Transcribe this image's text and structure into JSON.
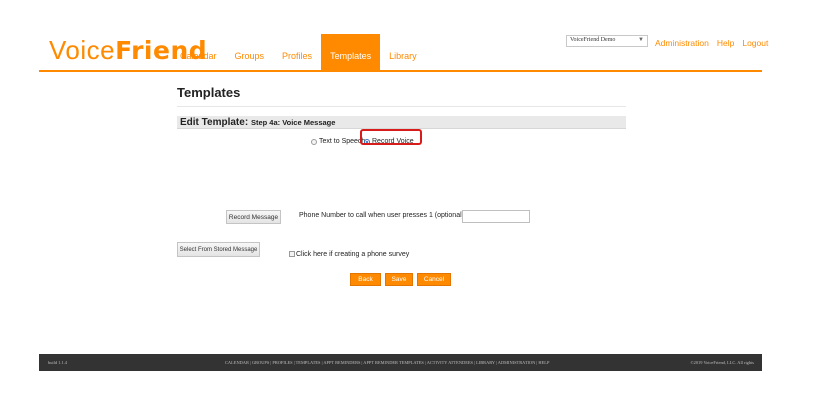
{
  "brand": {
    "logo_light": "Voice",
    "logo_bold": "Friend"
  },
  "nav": {
    "items": [
      {
        "label": "Calendar"
      },
      {
        "label": "Groups"
      },
      {
        "label": "Profiles"
      },
      {
        "label": "Templates",
        "active": true
      },
      {
        "label": "Library"
      }
    ]
  },
  "account": {
    "selected": "VoiceFriend Demo"
  },
  "top_links": {
    "administration": "Administration",
    "help": "Help",
    "logout": "Logout"
  },
  "page": {
    "title": "Templates",
    "section_title": "Edit Template:",
    "section_subtitle": "Step 4a: Voice Message",
    "options": {
      "text_to_speech": "Text to Speech",
      "record_voice": "Record Voice",
      "selected": "record_voice"
    },
    "record_button": "Record Message",
    "phone_label": "Phone Number to call when user presses 1 (optional):",
    "phone_value": "",
    "stored_button": "Select From Stored Message",
    "survey_label": "Click here if creating a phone survey",
    "buttons": {
      "back": "Back",
      "save": "Save",
      "cancel": "Cancel"
    }
  },
  "footer": {
    "build": "build 1.1.4",
    "links": "CALENDAR | GROUPS | PROFILES | TEMPLATES | APPT REMINDERS | APPT REMINDER TEMPLATES | ACTIVITY ATTENDEES | LIBRARY | ADMINISTRATION | HELP",
    "copyright": "©2019 VoiceFriend, LLC. All rights"
  },
  "colors": {
    "accent": "#ff8a00",
    "footer_bg": "#333333",
    "highlight": "#d81c1c"
  }
}
